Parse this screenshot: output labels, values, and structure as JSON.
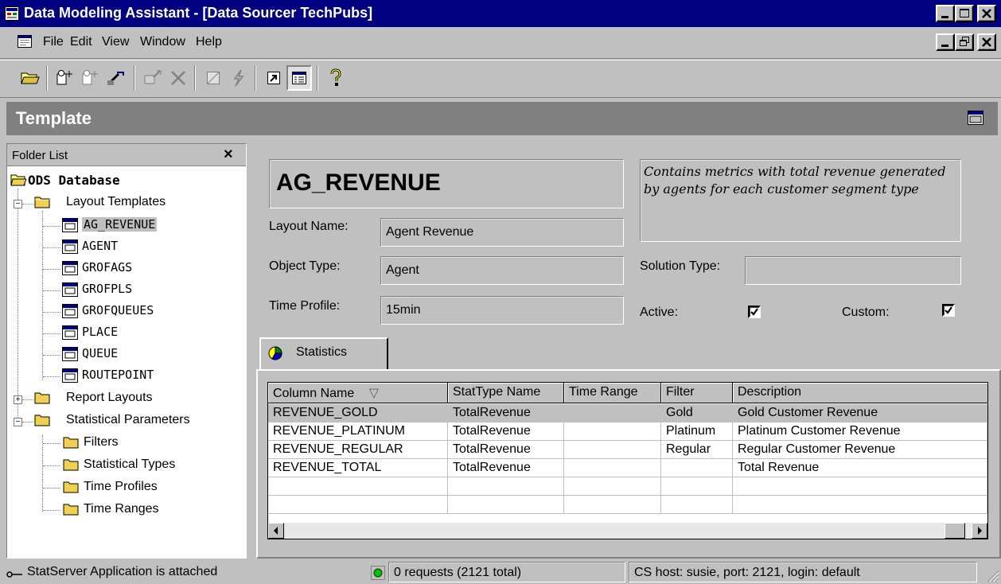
{
  "window": {
    "title": "Data Modeling Assistant - [Data Sourcer TechPubs]",
    "colors": {
      "titlebar": "#000080",
      "face": "#c0c0c0",
      "banner": "#808080",
      "status_ok": "#00c000"
    }
  },
  "menu": {
    "file": "File",
    "edit": "Edit",
    "view": "View",
    "window": "Window",
    "help": "Help"
  },
  "toolbar": {
    "icons": [
      "open-folder-icon",
      "new-layout-icon",
      "copy-layout-icon",
      "wizard-icon",
      "activate-icon",
      "delete-icon",
      "checkbox-icon",
      "lightning-icon",
      "arrow-icon",
      "grid-view-icon",
      "help-icon"
    ]
  },
  "banner": {
    "title": "Template"
  },
  "folder_list": {
    "header": "Folder List",
    "close": "×",
    "root": "ODS Database",
    "layout_templates": "Layout Templates",
    "templates": [
      "AG_REVENUE",
      "AGENT",
      "GROFAGS",
      "GROFPLS",
      "GROFQUEUES",
      "PLACE",
      "QUEUE",
      "ROUTEPOINT"
    ],
    "report_layouts": "Report Layouts",
    "statistical_parameters": "Statistical Parameters",
    "params": [
      "Filters",
      "Statistical Types",
      "Time Profiles",
      "Time Ranges"
    ]
  },
  "detail": {
    "name": "AG_REVENUE",
    "description": "Contains metrics with total revenue generated by agents for each customer segment type",
    "layout_name_label": "Layout Name:",
    "layout_name": "Agent Revenue",
    "object_type_label": "Object Type:",
    "object_type": "Agent",
    "time_profile_label": "Time Profile:",
    "time_profile": "15min",
    "solution_type_label": "Solution Type:",
    "solution_type": "",
    "active_label": "Active:",
    "active": true,
    "custom_label": "Custom:",
    "custom": true
  },
  "tabs": {
    "statistics": "Statistics"
  },
  "grid": {
    "headers": [
      "Column Name",
      "StatType Name",
      "Time Range",
      "Filter",
      "Description"
    ],
    "sort_indicator": "▽",
    "rows": [
      [
        "REVENUE_GOLD",
        "TotalRevenue",
        "",
        "Gold",
        "Gold Customer Revenue"
      ],
      [
        "REVENUE_PLATINUM",
        "TotalRevenue",
        "",
        "Platinum",
        "Platinum Customer Revenue"
      ],
      [
        "REVENUE_REGULAR",
        "TotalRevenue",
        "",
        "Regular",
        "Regular Customer Revenue"
      ],
      [
        "REVENUE_TOTAL",
        "TotalRevenue",
        "",
        "",
        "Total Revenue"
      ],
      [
        "",
        "",
        "",
        "",
        ""
      ],
      [
        "",
        "",
        "",
        "",
        ""
      ]
    ]
  },
  "status": {
    "attached": "StatServer Application is attached",
    "requests": "0 requests (2121 total)",
    "host": "CS host: susie, port: 2121, login: default"
  }
}
